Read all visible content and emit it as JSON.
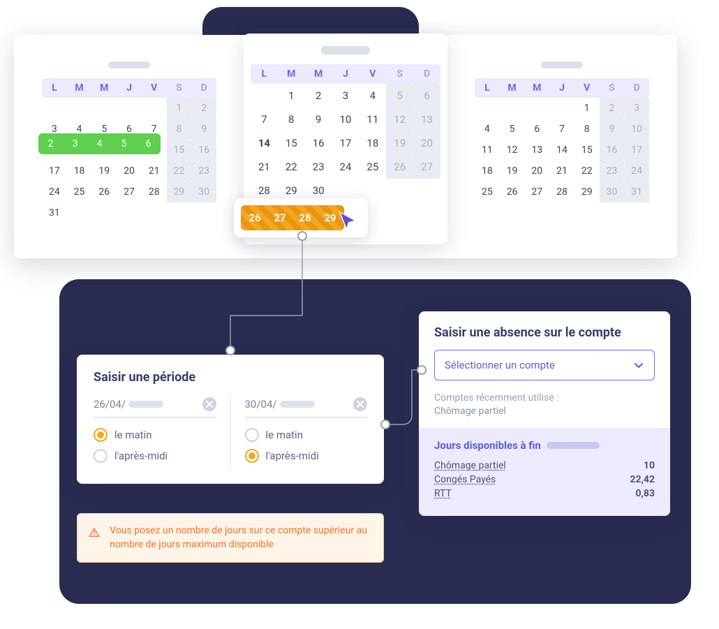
{
  "dow": [
    "L",
    "M",
    "M",
    "J",
    "V",
    "S",
    "D"
  ],
  "months": {
    "left": {
      "firstWeekdayCol": 5,
      "lastDay": 31,
      "greenRange": [
        2,
        3,
        4,
        5,
        6
      ]
    },
    "center": {
      "firstWeekdayCol": 1,
      "lastDay": 30,
      "boldDay": 14,
      "orangeRange": [
        26,
        27,
        28,
        29
      ]
    },
    "right": {
      "firstWeekdayCol": 4,
      "lastDay": 31
    }
  },
  "period": {
    "title": "Saisir une période",
    "start": {
      "value": "26/04/",
      "options": {
        "morning": "le matin",
        "afternoon": "l'après-midi"
      },
      "selected": "morning"
    },
    "end": {
      "value": "30/04/",
      "options": {
        "morning": "le matin",
        "afternoon": "l'après-midi"
      },
      "selected": "afternoon"
    }
  },
  "warning": {
    "text": "Vous posez un nombre de jours sur ce compte supérieur au nombre de jours maximum disponible"
  },
  "account": {
    "title": "Saisir une absence sur le compte",
    "select_placeholder": "Sélectionner un compte",
    "recent_label": "Comptes récemment utilisé :",
    "recent_value": "Chômage partiel",
    "days_title": "Jours disponibles à fin",
    "rows": [
      {
        "name": "Chômage partiel",
        "value": "10"
      },
      {
        "name": "Congés Payés",
        "value": "22,42"
      },
      {
        "name": "RTT",
        "value": "0,83"
      }
    ]
  }
}
